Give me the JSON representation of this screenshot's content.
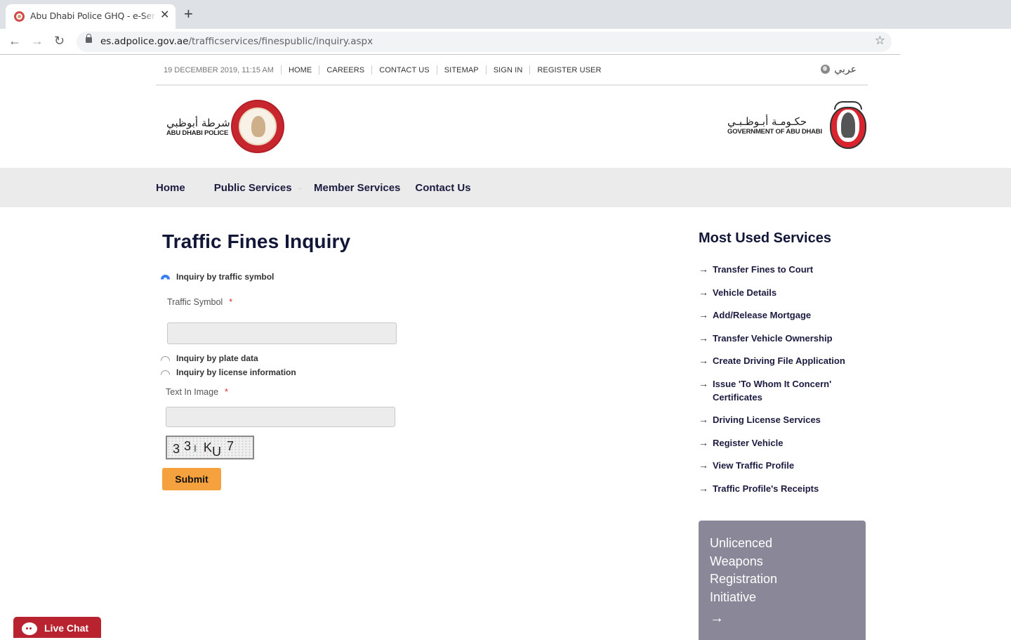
{
  "browser": {
    "tab_title": "Abu Dhabi Police GHQ - e-Services",
    "tab_close": "✕",
    "new_tab": "+",
    "back": "←",
    "forward": "→",
    "reload": "↻",
    "url_host": "es.adpolice.gov.ae",
    "url_path": "/trafficservices/finespublic/inquiry.aspx",
    "bookmark": "☆"
  },
  "utility_bar": {
    "date": "19 DECEMBER 2019, 11:15 AM",
    "links": [
      "HOME",
      "CAREERS",
      "CONTACT US",
      "SITEMAP",
      "SIGN IN",
      "REGISTER USER"
    ],
    "language": "عربي"
  },
  "logos": {
    "police_ar": "شرطة أبوظبي",
    "police_en": "ABU DHABI POLICE",
    "gov_ar": "حكـومـة أبـوظـبـي",
    "gov_en": "GOVERNMENT OF ABU DHABI"
  },
  "main_nav": {
    "items": [
      "Home",
      "Public Services",
      "Member Services",
      "Contact Us"
    ],
    "dropdown_chevron": "⌄"
  },
  "form": {
    "title": "Traffic Fines Inquiry",
    "options": [
      {
        "label": "Inquiry by traffic symbol",
        "checked": true
      },
      {
        "label": "Inquiry by plate data",
        "checked": false
      },
      {
        "label": "Inquiry by license information",
        "checked": false
      }
    ],
    "traffic_symbol_label": "Traffic Symbol",
    "traffic_symbol_value": "",
    "required_mark": "*",
    "captcha_label": "Text In Image",
    "captcha_value": "",
    "captcha_chars": [
      "3",
      "3",
      "I",
      "K",
      "U",
      "7"
    ],
    "submit_label": "Submit"
  },
  "sidebar": {
    "title": "Most Used Services",
    "arrow": "→",
    "services": [
      "Transfer Fines to Court",
      "Vehicle Details",
      "Add/Release Mortgage",
      "Transfer Vehicle Ownership",
      "Create Driving File Application",
      "Issue 'To Whom It Concern' Certificates",
      "Driving License Services",
      "Register Vehicle",
      "View Traffic Profile",
      "Traffic Profile's Receipts"
    ]
  },
  "promo": {
    "text": "Unlicenced Weapons Registration Initiative",
    "arrow": "→"
  },
  "live_chat": {
    "label": "Live Chat"
  },
  "colors": {
    "brand_navy": "#111636",
    "submit_orange": "#f4a13e",
    "live_chat_red": "#b9232f",
    "promo_gray": "#8a8799",
    "nav_bg": "#ebebeb"
  }
}
